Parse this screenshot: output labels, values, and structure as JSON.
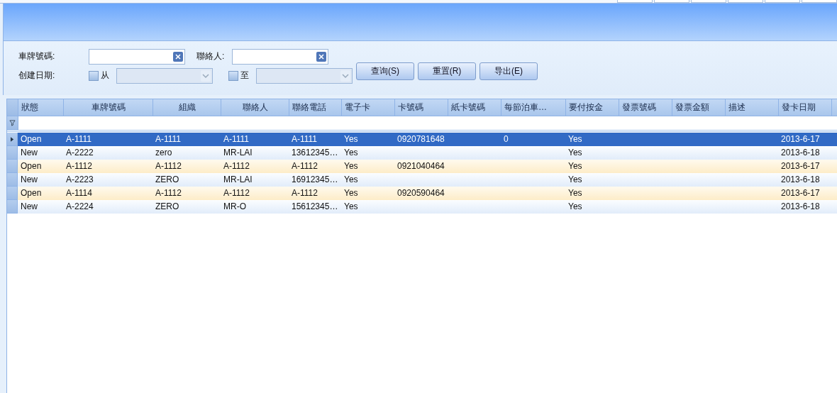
{
  "filters": {
    "plate": {
      "label": "車牌號碼:"
    },
    "contact": {
      "label": "聯絡人:"
    },
    "created": {
      "label": "创建日期:",
      "from": {
        "label": "从",
        "checked": false,
        "disabled": true
      },
      "to": {
        "label": "至",
        "checked": false,
        "disabled": true
      }
    }
  },
  "buttons": [
    "查询(S)",
    "重置(R)",
    "导出(E)"
  ],
  "table": {
    "columns": [
      "狀態",
      "車牌號碼",
      "組織",
      "聯絡人",
      "聯絡電話",
      "電子卡",
      "卡號碼",
      "紙卡號碼",
      "每節泊車…",
      "要付按金",
      "發票號碼",
      "發票金額",
      "描述",
      "發卡日期"
    ],
    "rows": [
      {
        "selected": true,
        "cells": [
          "Open",
          "A-1111",
          "A-1111",
          "A-1111",
          "A-1111",
          "Yes",
          "0920781648",
          "",
          "0",
          "Yes",
          "",
          "",
          "",
          "2013-6-17"
        ]
      },
      {
        "selected": false,
        "cells": [
          "New",
          "A-2222",
          "zero",
          "MR-LAI",
          "13612345…",
          "Yes",
          "",
          "",
          "",
          "Yes",
          "",
          "",
          "",
          "2013-6-18"
        ]
      },
      {
        "selected": false,
        "cells": [
          "Open",
          "A-1112",
          "A-1112",
          "A-1112",
          "A-1112",
          "Yes",
          "0921040464",
          "",
          "",
          "Yes",
          "",
          "",
          "",
          "2013-6-17"
        ]
      },
      {
        "selected": false,
        "cells": [
          "New",
          "A-2223",
          "ZERO",
          "MR-LAI",
          "16912345…",
          "Yes",
          "",
          "",
          "",
          "Yes",
          "",
          "",
          "",
          "2013-6-18"
        ]
      },
      {
        "selected": false,
        "cells": [
          "Open",
          "A-1114",
          "A-1112",
          "A-1112",
          "A-1112",
          "Yes",
          "0920590464",
          "",
          "",
          "Yes",
          "",
          "",
          "",
          "2013-6-17"
        ]
      },
      {
        "selected": false,
        "cells": [
          "New",
          "A-2224",
          "ZERO",
          "MR-O",
          "15612345…",
          "Yes",
          "",
          "",
          "",
          "Yes",
          "",
          "",
          "",
          "2013-6-18"
        ]
      }
    ]
  }
}
